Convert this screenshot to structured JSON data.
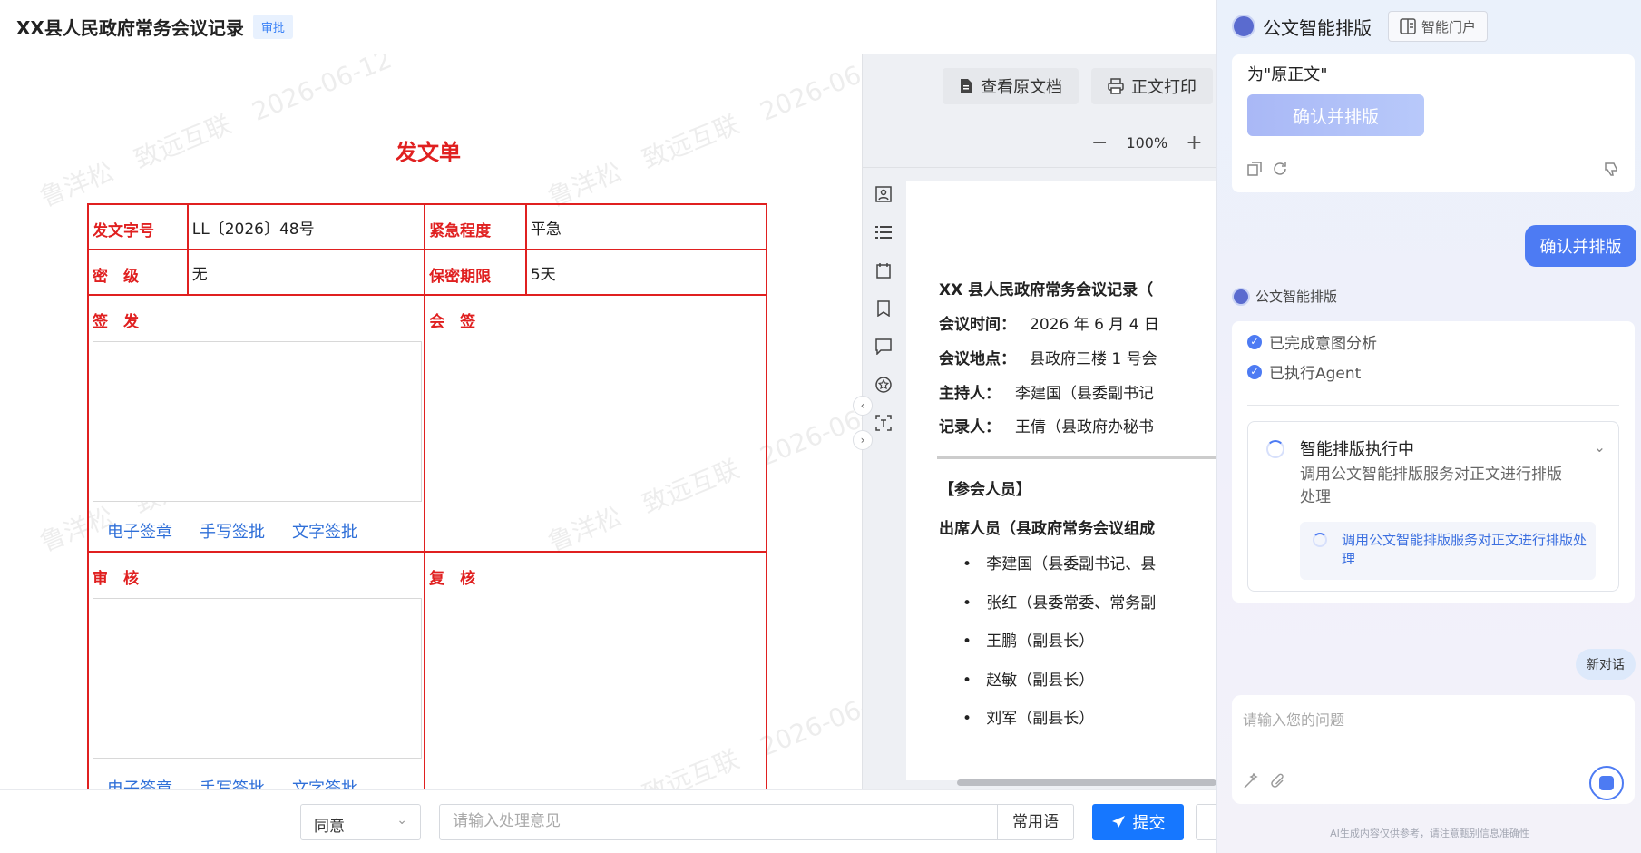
{
  "header": {
    "title": "XX县人民政府常务会议记录",
    "badge": "审批"
  },
  "watermark": {
    "text": "鲁洋松　致远互联　2026-06-12"
  },
  "form": {
    "title": "发文单",
    "rows": [
      {
        "label1": "发文字号",
        "value1": "LL〔2026〕48号",
        "label2": "紧急程度",
        "value2": "平急"
      },
      {
        "label1": "密　级",
        "value1": "无",
        "label2": "保密期限",
        "value2": "5天"
      }
    ],
    "sections": [
      {
        "left": "签　发",
        "right": "会　签"
      },
      {
        "left": "审　核",
        "right": "复　核"
      }
    ],
    "sign_links": [
      "电子签章",
      "手写签批",
      "文字签批"
    ]
  },
  "doc_viewer": {
    "view_original": "查看原文档",
    "print": "正文打印",
    "zoom": "100%",
    "content": {
      "title": "XX 县人民政府常务会议记录（",
      "meta": [
        {
          "label": "会议时间：",
          "value": "2026 年 6 月 4 日"
        },
        {
          "label": "会议地点：",
          "value": "县政府三楼 1 号会"
        },
        {
          "label": "主持人：",
          "value": "李建国（县委副书记"
        },
        {
          "label": "记录人：",
          "value": "王倩（县政府办秘书"
        }
      ],
      "section": "【参会人员】",
      "subsection": "出席人员（县政府常务会议组成",
      "attendees": [
        "李建国（县委副书记、县",
        "张红（县委常委、常务副",
        "王鹏（副县长）",
        "赵敏（副县长）",
        "刘军（副县长）"
      ]
    }
  },
  "bottom": {
    "select_value": "同意",
    "opinion_placeholder": "请输入处理意见",
    "phrases": "常用语",
    "submit": "提交"
  },
  "ai_panel": {
    "title": "公文智能排版",
    "portal": "智能门户",
    "prev_text": "为\"原正文\"",
    "confirm_button": "确认并排版",
    "user_message": "确认并排版",
    "bot_name": "公文智能排版",
    "steps": [
      "已完成意图分析",
      "已执行Agent"
    ],
    "exec_title": "智能排版执行中",
    "exec_desc": "调用公文智能排版服务对正文进行排版处理",
    "exec_sub": "调用公文智能排版服务对正文进行排版处理",
    "new_chat": "新对话",
    "input_placeholder": "请输入您的问题",
    "disclaimer": "AI生成内容仅供参考，请注意甄别信息准确性"
  },
  "colors": {
    "form_red": "#e02020",
    "accent_blue": "#1677ff",
    "ai_blue": "#4d7bf3"
  }
}
